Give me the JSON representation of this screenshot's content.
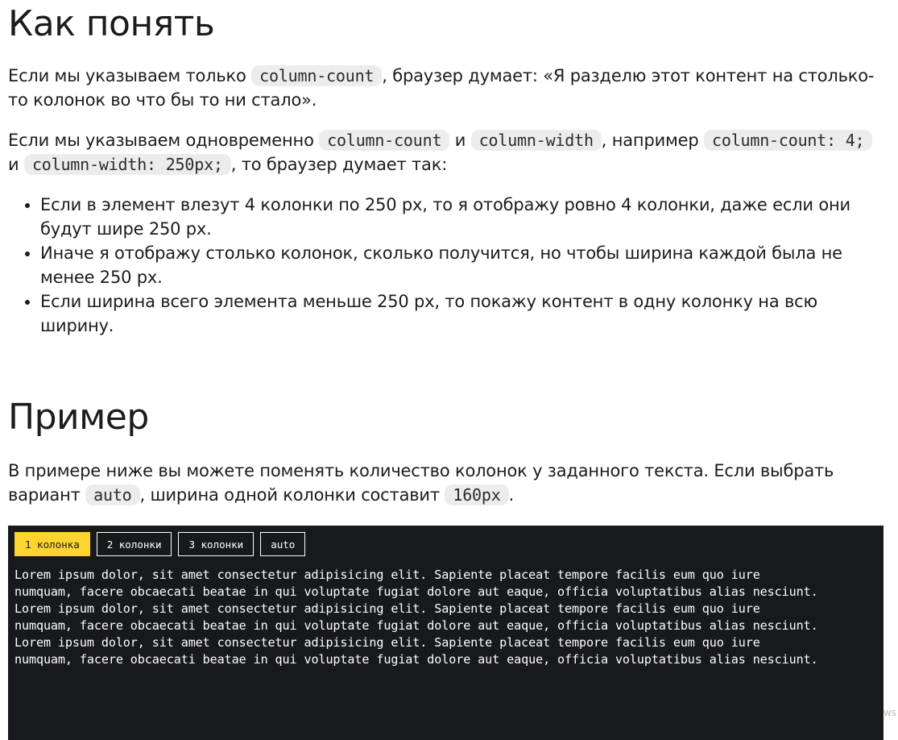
{
  "section1": {
    "title": "Как понять",
    "p1": {
      "t1": "Если мы указываем только ",
      "code1": "column-count",
      "t2": ", браузер думает: «Я разделю этот контент на столько-то колонок во что бы то ни стало»."
    },
    "p2": {
      "t1": "Если мы указываем одновременно ",
      "code1": "column-count",
      "t2": " и ",
      "code2": "column-width",
      "t3": ", например ",
      "code3": "column-count: 4;",
      "t4": " и ",
      "code4": "column-width: 250px;",
      "t5": ", то браузер думает так:"
    },
    "list": [
      "Если в элемент влезут 4 колонки по 250 px, то я отображу ровно 4 колонки, даже если они будут шире 250 px.",
      "Иначе я отображу столько колонок, сколько получится, но чтобы ширина каждой была не менее 250 px.",
      "Если ширина всего элемента меньше 250 px, то покажу контент в одну колонку на всю ширину."
    ]
  },
  "section2": {
    "title": "Пример",
    "p": {
      "t1": "В примере ниже вы можете поменять количество колонок у заданного текста. Если выбрать вариант ",
      "code1": "auto",
      "t2": ", ширина одной колонки составит ",
      "code2": "160px",
      "t3": "."
    }
  },
  "demo": {
    "buttons": [
      {
        "label": "1 колонка",
        "active": true
      },
      {
        "label": "2 колонки",
        "active": false
      },
      {
        "label": "3 колонки",
        "active": false
      },
      {
        "label": "auto",
        "active": false
      }
    ],
    "lines": [
      "Lorem ipsum dolor, sit amet consectetur adipisicing elit. Sapiente placeat tempore facilis eum quo iure",
      "numquam, facere obcaecati beatae in qui voluptate fugiat dolore aut eaque, officia voluptatibus alias nesciunt.",
      "Lorem ipsum dolor, sit amet consectetur adipisicing elit. Sapiente placeat tempore facilis eum quo iure",
      "numquam, facere obcaecati beatae in qui voluptate fugiat dolore aut eaque, officia voluptatibus alias nesciunt.",
      "Lorem ipsum dolor, sit amet consectetur adipisicing elit. Sapiente placeat tempore facilis eum quo iure",
      "numquam, facere obcaecati beatae in qui voluptate fugiat dolore aut eaque, officia voluptatibus alias nesciunt."
    ],
    "colors": {
      "background": "#18191c",
      "active": "#fdd42f",
      "text": "#ffffff"
    }
  },
  "corner_label": "ws"
}
